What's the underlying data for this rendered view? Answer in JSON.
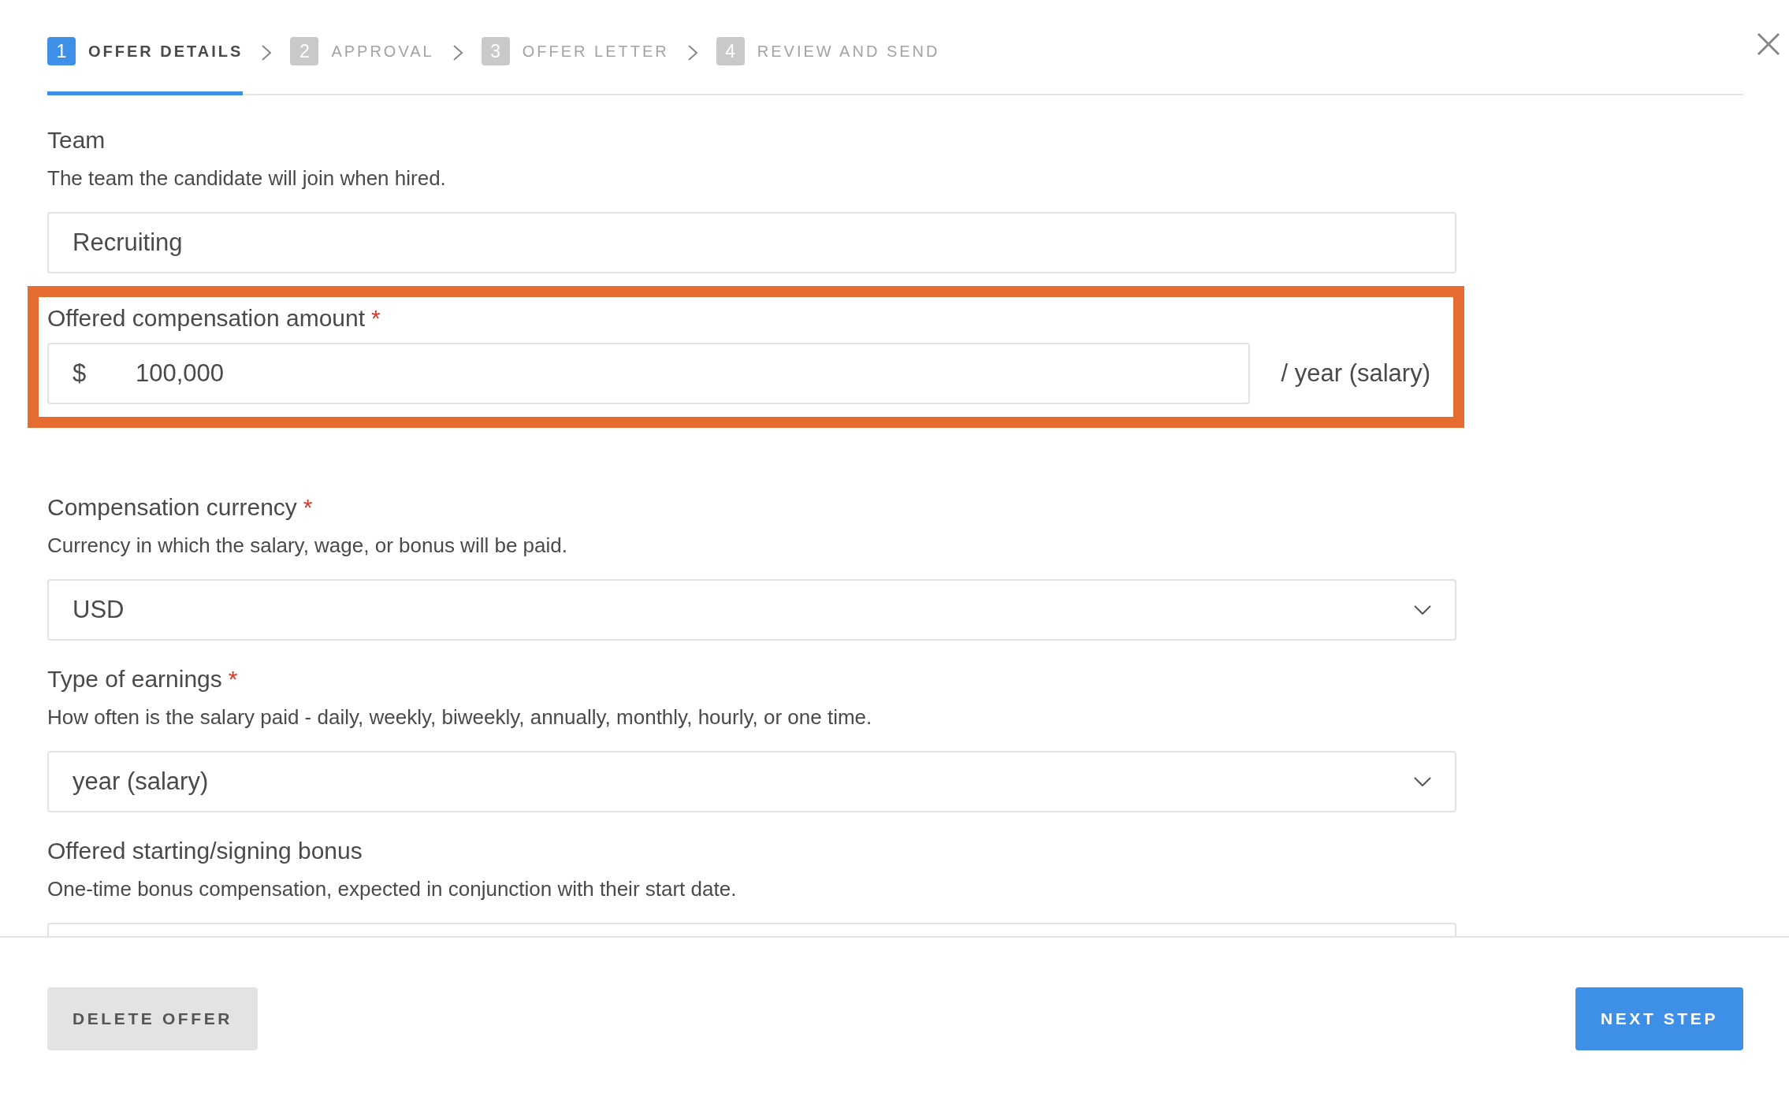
{
  "steps": [
    {
      "number": "1",
      "label": "OFFER DETAILS",
      "selected": true
    },
    {
      "number": "2",
      "label": "APPROVAL",
      "selected": false
    },
    {
      "number": "3",
      "label": "OFFER LETTER",
      "selected": false
    },
    {
      "number": "4",
      "label": "REVIEW AND SEND",
      "selected": false
    }
  ],
  "fields": [
    {
      "kind": "text",
      "label": "Team",
      "required": false,
      "highlighted": false,
      "description": "The team the candidate will join when hired.",
      "value": "Recruiting"
    },
    {
      "kind": "amount",
      "label": "Offered compensation amount",
      "required": true,
      "highlighted": true,
      "prefix": "$",
      "value": "100,000",
      "suffix": "/ year (salary)"
    },
    {
      "kind": "select",
      "label": "Compensation currency",
      "required": true,
      "highlighted": false,
      "description": "Currency in which the salary, wage, or bonus will be paid.",
      "value": "USD"
    },
    {
      "kind": "select",
      "label": "Type of earnings",
      "required": true,
      "highlighted": false,
      "description": "How often is the salary paid - daily, weekly, biweekly, annually, monthly, hourly, or one time.",
      "value": "year (salary)"
    },
    {
      "kind": "text",
      "label": "Offered starting/signing bonus",
      "required": false,
      "highlighted": false,
      "description": "One-time bonus compensation, expected in conjunction with their start date."
    }
  ],
  "required_mark": "*",
  "footer": {
    "delete_button": "DELETE OFFER",
    "next_button": "NEXT STEP"
  }
}
